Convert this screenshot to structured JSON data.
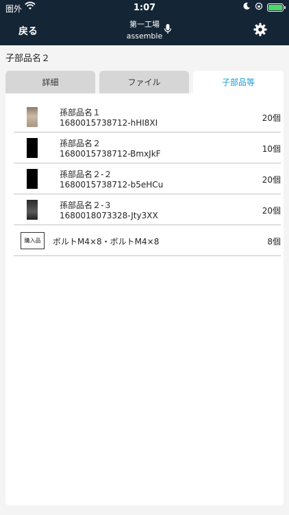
{
  "status_bar": {
    "carrier": "圏外",
    "time": "1:07"
  },
  "nav": {
    "back_label": "戻る",
    "factory": "第一工場",
    "subtitle": "assemble"
  },
  "section_title": "子部品名２",
  "tabs": [
    {
      "label": "詳細"
    },
    {
      "label": "ファイル"
    },
    {
      "label": "子部品等"
    }
  ],
  "items": [
    {
      "name": "孫部品名１",
      "code": "1680015738712-hHI8XI",
      "qty": "20個"
    },
    {
      "name": "孫部品名２",
      "code": "1680015738712-BmxJkF",
      "qty": "10個"
    },
    {
      "name": "孫部品名２-２",
      "code": "1680015738712-b5eHCu",
      "qty": "20個"
    },
    {
      "name": "孫部品名２-３",
      "code": "1680018073328-Jty3XX",
      "qty": "20個"
    }
  ],
  "purchase_item": {
    "badge": "購入品",
    "name": "ボルトM4×8・ボルトM4×8",
    "qty": "8個"
  },
  "colors": {
    "nav_bg": "#142535",
    "active_tab_text": "#1b9ad6",
    "battery_fill": "#4cd964"
  }
}
